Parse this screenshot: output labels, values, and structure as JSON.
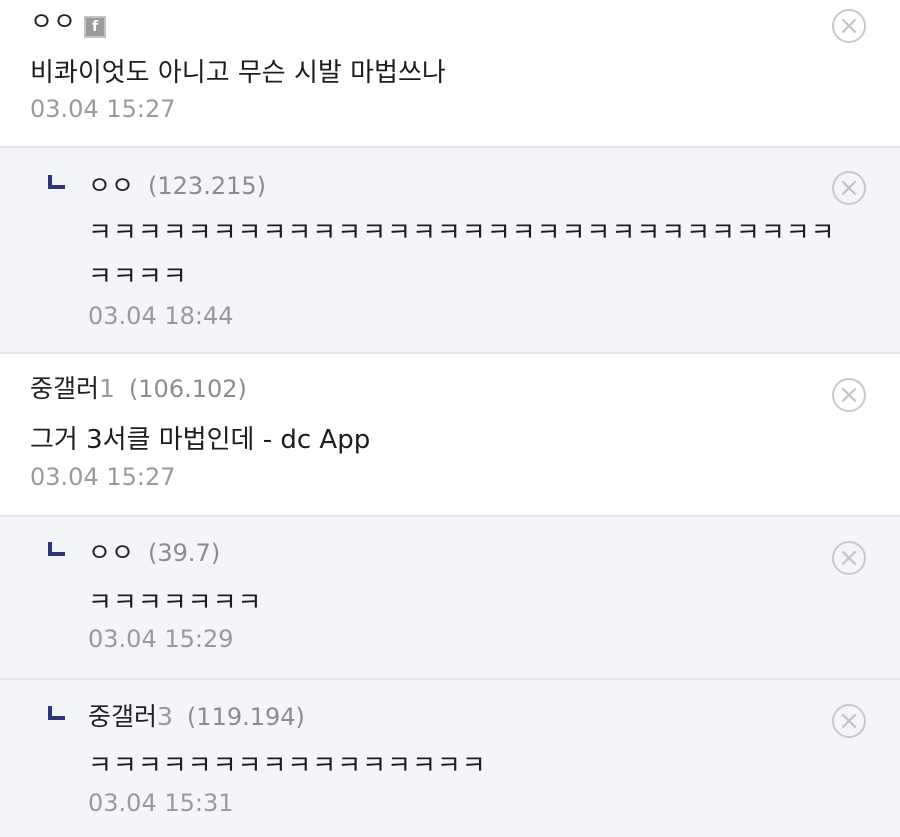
{
  "comments": [
    {
      "name": "ㅇㅇ",
      "number": "",
      "ip": "",
      "text": "비콰이엇도 아니고 무슨 시발 마법쓰나",
      "time": "03.04 15:27",
      "nick_icon": "f"
    },
    {
      "name": "ㅇㅇ",
      "number": "",
      "ip": "(123.215)",
      "text": "ㅋㅋㅋㅋㅋㅋㅋㅋㅋㅋㅋㅋㅋㅋㅋㅋㅋㅋㅋㅋㅋㅋㅋㅋㅋㅋㅋㅋㅋㅋ",
      "text2": "ㅋㅋㅋㅋ",
      "time": "03.04 18:44"
    },
    {
      "name": "중갤러",
      "number": "1",
      "ip": "(106.102)",
      "text": "그거 3서클 마법인데 - dc App",
      "time": "03.04 15:27"
    },
    {
      "name": "ㅇㅇ",
      "number": "",
      "ip": "(39.7)",
      "text": "ㅋㅋㅋㅋㅋㅋㅋ",
      "time": "03.04 15:29"
    },
    {
      "name": "중갤러",
      "number": "3",
      "ip": "(119.194)",
      "text": "ㅋㅋㅋㅋㅋㅋㅋㅋㅋㅋㅋㅋㅋㅋㅋㅋ",
      "time": "03.04 15:31"
    }
  ],
  "icons": {
    "delete": "circle-x-icon",
    "reply_indicator": "reply-arrow-icon"
  }
}
